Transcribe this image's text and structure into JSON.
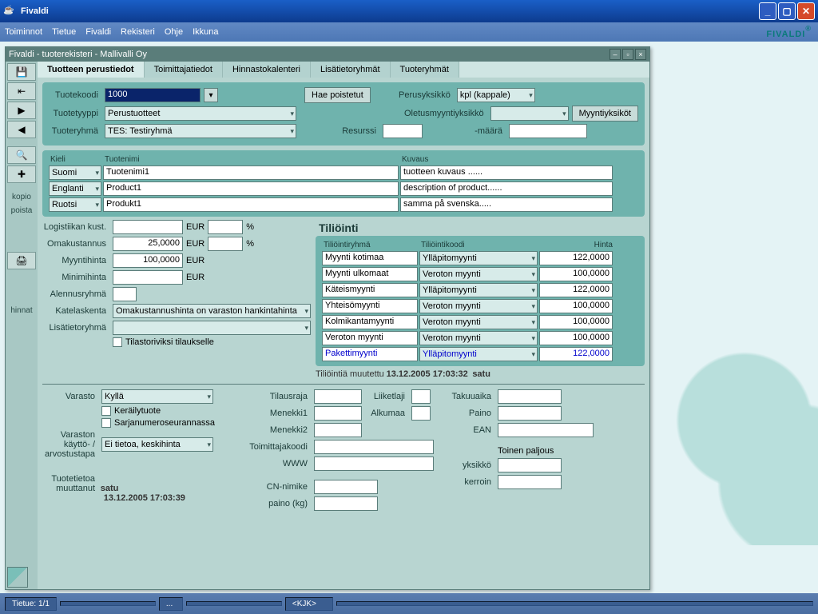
{
  "window": {
    "title": "Fivaldi"
  },
  "menubar": [
    "Toiminnot",
    "Tietue",
    "Fivaldi",
    "Rekisteri",
    "Ohje",
    "Ikkuna"
  ],
  "brand": "FIVALDI",
  "inner": {
    "title": "Fivaldi - tuoterekisteri - Mallivalli Oy"
  },
  "sidebar": {
    "labels": {
      "kopio": "kopio",
      "poista": "poista",
      "hinnat": "hinnat"
    }
  },
  "tabs": [
    "Tuotteen perustiedot",
    "Toimittajatiedot",
    "Hinnastokalenteri",
    "Lisätietoryhmät",
    "Tuoteryhmät"
  ],
  "top": {
    "tuotekoodi_lbl": "Tuotekoodi",
    "tuotekoodi": "1000",
    "tuotetyyppi_lbl": "Tuotetyyppi",
    "tuotetyyppi": "Perustuotteet",
    "tuoteryhma_lbl": "Tuoteryhmä",
    "tuoteryhma": "TES: Testiryhmä",
    "hae_poistetut": "Hae poistetut",
    "perusyksikko_lbl": "Perusyksikkö",
    "perusyksikko": "kpl (kappale)",
    "oletus_lbl": "Oletusmyyntiyksikkö",
    "oletus": "",
    "myyntiyksikot": "Myyntiyksiköt",
    "resurssi_lbl": "Resurssi",
    "resurssi": "",
    "maara_lbl": "-määrä",
    "maara": ""
  },
  "lang": {
    "hdr": {
      "kieli": "Kieli",
      "tuotenimi": "Tuotenimi",
      "kuvaus": "Kuvaus"
    },
    "rows": [
      {
        "kieli": "Suomi",
        "nimi": "Tuotenimi1",
        "kuvaus": "tuotteen kuvaus ......"
      },
      {
        "kieli": "Englanti",
        "nimi": "Product1",
        "kuvaus": "description of product......"
      },
      {
        "kieli": "Ruotsi",
        "nimi": "Produkt1",
        "kuvaus": "samma på svenska....."
      }
    ]
  },
  "prices": {
    "logkust_lbl": "Logistiikan kust.",
    "logkust": "",
    "eur": "EUR",
    "pct": "%",
    "omakust_lbl": "Omakustannus",
    "omakust": "25,0000",
    "myyntihinta_lbl": "Myyntihinta",
    "myyntihinta": "100,0000",
    "minimihinta_lbl": "Minimihinta",
    "minimihinta": "",
    "alennusryhma_lbl": "Alennusryhmä",
    "alennusryhma": "",
    "katelaskenta_lbl": "Katelaskenta",
    "katelaskenta": "Omakustannushinta on varaston hankintahinta",
    "lisatietoryhma_lbl": "Lisätietoryhmä",
    "lisatietoryhma": "",
    "tilastoriviksi": "Tilastoriviksi tilaukselle"
  },
  "tili": {
    "title": "Tiliöinti",
    "hdr": {
      "ryhma": "Tiliöintiryhmä",
      "koodi": "Tiliöintikoodi",
      "hinta": "Hinta"
    },
    "rows": [
      {
        "ryhma": "Myynti kotimaa",
        "koodi": "Ylläpitomyynti",
        "hinta": "122,0000"
      },
      {
        "ryhma": "Myynti ulkomaat",
        "koodi": "Veroton myynti",
        "hinta": "100,0000"
      },
      {
        "ryhma": "Käteismyynti",
        "koodi": "Ylläpitomyynti",
        "hinta": "122,0000"
      },
      {
        "ryhma": "Yhteisömyynti",
        "koodi": "Veroton myynti",
        "hinta": "100,0000"
      },
      {
        "ryhma": "Kolmikantamyynti",
        "koodi": "Veroton myynti",
        "hinta": "100,0000"
      },
      {
        "ryhma": "Veroton myynti",
        "koodi": "Veroton myynti",
        "hinta": "100,0000"
      },
      {
        "ryhma": "Pakettimyynti",
        "koodi": "Ylläpitomyynti",
        "hinta": "122,0000",
        "blue": true
      }
    ],
    "muutettu_lbl": "Tiliöintiä muutettu",
    "muutettu_ts": "13.12.2005 17:03:32",
    "muutettu_user": "satu"
  },
  "lower": {
    "varasto_lbl": "Varasto",
    "varasto": "Kyllä",
    "kerailytuote": "Keräilytuote",
    "sarjanumero": "Sarjanumeroseurannassa",
    "vkaytto_lbl": "Varaston käyttö- / arvostustapa",
    "vkaytto": "Ei tietoa, keskihinta",
    "tuotetietoa_lbl": "Tuotetietoa muuttanut",
    "tuotetietoa_user": "satu",
    "tuotetietoa_ts": "13.12.2005 17:03:39",
    "tilausraja_lbl": "Tilausraja",
    "menekki1_lbl": "Menekki1",
    "menekki2_lbl": "Menekki2",
    "toimittajakoodi_lbl": "Toimittajakoodi",
    "www_lbl": "WWW",
    "liiketlaji_lbl": "Liiketlaji",
    "alkumaa_lbl": "Alkumaa",
    "takuuaika_lbl": "Takuuaika",
    "paino_lbl": "Paino",
    "ean_lbl": "EAN",
    "cnnimike_lbl": "CN-nimike",
    "painokg_lbl": "paino (kg)",
    "toinenpaljous_lbl": "Toinen paljous",
    "yksikko_lbl": "yksikkö",
    "kerroin_lbl": "kerroin"
  },
  "status": {
    "tietue": "Tietue: 1/1",
    "dots": "...",
    "kjk": "<KJK>"
  }
}
